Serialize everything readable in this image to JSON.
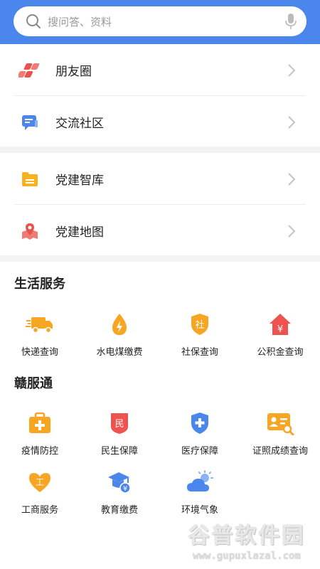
{
  "search": {
    "placeholder": "搜问答、资料"
  },
  "menu_groups": [
    {
      "items": [
        {
          "label": "朋友圈",
          "icon": "moments-icon"
        },
        {
          "label": "交流社区",
          "icon": "chat-icon"
        }
      ]
    },
    {
      "items": [
        {
          "label": "党建智库",
          "icon": "folder-icon"
        },
        {
          "label": "党建地图",
          "icon": "map-pin-icon"
        }
      ]
    }
  ],
  "life_services": {
    "title": "生活服务",
    "items": [
      {
        "label": "快递查询",
        "icon": "truck-icon"
      },
      {
        "label": "水电煤缴费",
        "icon": "energy-drop-icon"
      },
      {
        "label": "社保查询",
        "icon": "shield-social-icon",
        "glyph": "社"
      },
      {
        "label": "公积金查询",
        "icon": "house-yuan-icon",
        "glyph": "¥"
      }
    ]
  },
  "gan_fu_tong": {
    "title": "赣服通",
    "items": [
      {
        "label": "疫情防控",
        "icon": "medkit-icon"
      },
      {
        "label": "民生保障",
        "icon": "badge-min-icon",
        "glyph": "民"
      },
      {
        "label": "医疗保障",
        "icon": "medical-shield-icon"
      },
      {
        "label": "证照成绩查询",
        "icon": "id-card-search-icon"
      },
      {
        "label": "工商服务",
        "icon": "heart-commerce-icon",
        "glyph": "工"
      },
      {
        "label": "教育缴费",
        "icon": "graduation-cap-icon",
        "glyph": "¥"
      },
      {
        "label": "环境气象",
        "icon": "weather-icon"
      }
    ]
  },
  "watermark": {
    "title": "谷普软件园",
    "url": "www.gupuxlazal.com"
  },
  "colors": {
    "header": "#4a86ec",
    "orange": "#f6a623",
    "red": "#ef5350",
    "blue": "#4a86ec"
  }
}
